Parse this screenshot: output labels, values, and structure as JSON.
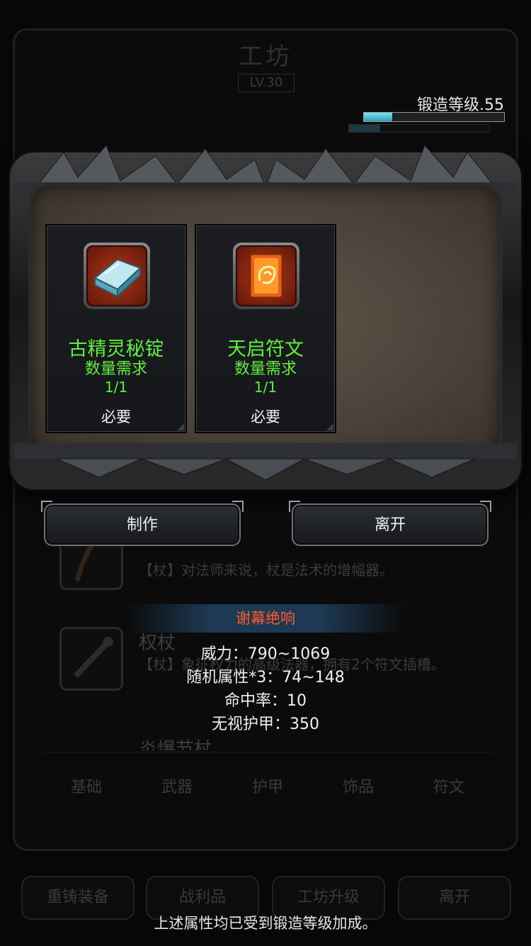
{
  "background": {
    "title": "工坊",
    "level": "LV.30",
    "forge": {
      "label": "锻造等级.55",
      "progress": 0.2
    },
    "list": [
      {
        "desc": "【杖】对法师来说，杖是法术的增幅器。"
      },
      {
        "name": "权杖",
        "desc": "【杖】象征权力的高级法器，拥有2个符文插槽。"
      },
      {
        "name": "炎爆节杖"
      }
    ],
    "tabs": [
      "基础",
      "武器",
      "护甲",
      "饰品",
      "符文"
    ],
    "bottom_buttons": [
      "重铸装备",
      "战利品",
      "工坊升级",
      "离开"
    ]
  },
  "modal": {
    "materials": [
      {
        "name": "古精灵秘锭",
        "requirement_label": "数量需求",
        "quantity": "1/1",
        "status": "必要",
        "icon": "ingot-icon"
      },
      {
        "name": "天启符文",
        "requirement_label": "数量需求",
        "quantity": "1/1",
        "status": "必要",
        "icon": "rune-icon"
      }
    ],
    "craft_button": "制作",
    "leave_button": "离开"
  },
  "tooltip": {
    "title": "谢幕绝响",
    "stats": [
      "威力：790~1069",
      "随机属性*3：74~148",
      "命中率：10",
      "无视护甲：350"
    ]
  },
  "footer_note": "上述属性均已受到锻造等级加成。",
  "colors": {
    "accent_green": "#5ff03c",
    "title_red": "#ff5a2a",
    "bar_cyan": "#4fc3d6"
  }
}
